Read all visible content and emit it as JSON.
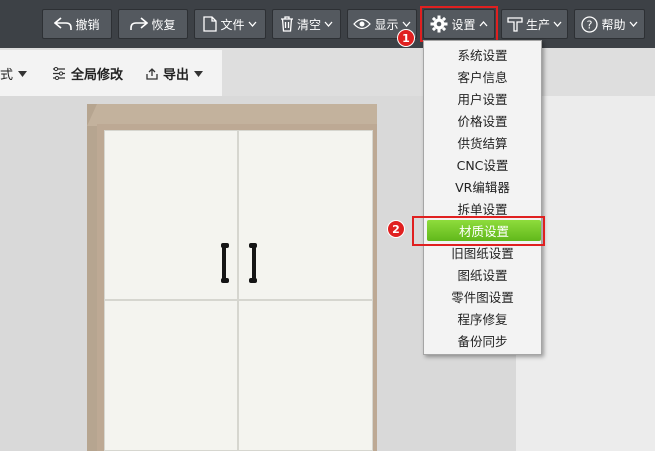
{
  "toolbar": {
    "undo": "撤销",
    "redo": "恢复",
    "file": "文件",
    "clear": "清空",
    "display": "显示",
    "settings": "设置",
    "production": "生产",
    "help": "帮助"
  },
  "subbar": {
    "style_partial": "式",
    "global_modify": "全局修改",
    "export": "导出"
  },
  "settings_menu": {
    "items": [
      "系统设置",
      "客户信息",
      "用户设置",
      "价格设置",
      "供货结算",
      "CNC设置",
      "VR编辑器",
      "拆单设置",
      "材质设置",
      "旧图纸设置",
      "图纸设置",
      "零件图设置",
      "程序修复",
      "备份同步"
    ],
    "selected": "材质设置"
  },
  "annotations": {
    "step1": "1",
    "step2": "2"
  },
  "colors": {
    "highlight": "#e02020",
    "selected_bg": "#6cc423",
    "toolbar_bg": "#3d4146"
  }
}
